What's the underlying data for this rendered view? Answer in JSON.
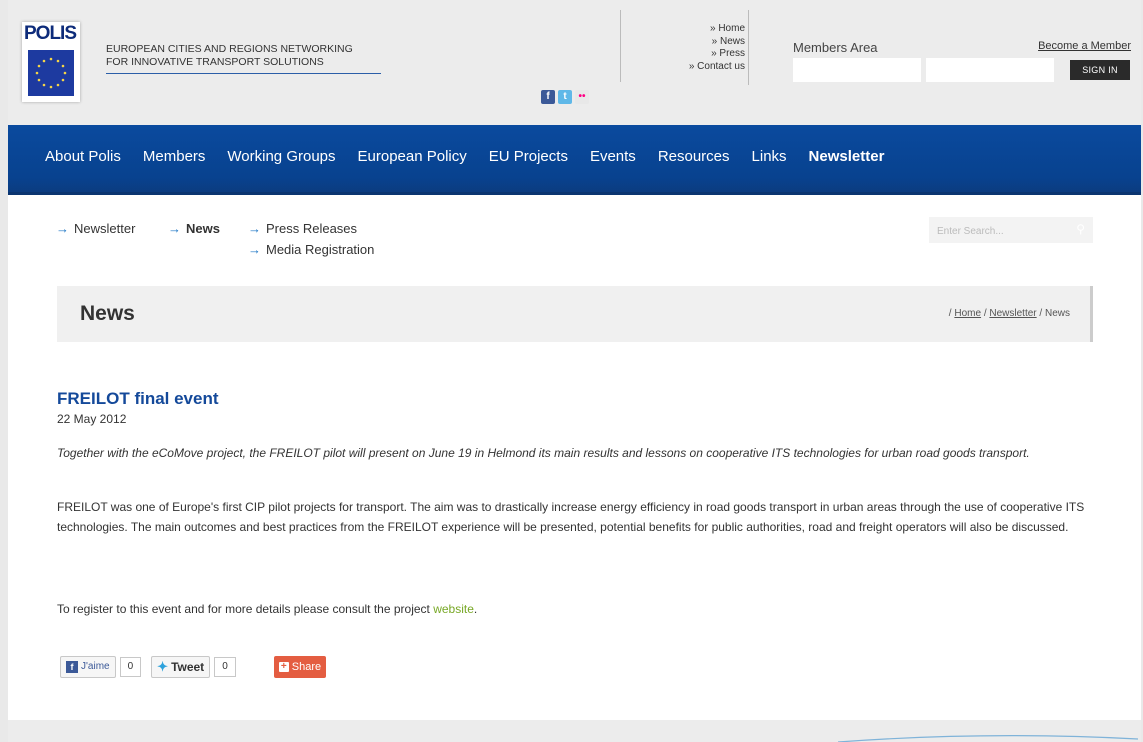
{
  "header": {
    "logo_text": "POLIS",
    "tagline_line1": "EUROPEAN CITIES AND REGIONS NETWORKING",
    "tagline_line2": "FOR INNOVATIVE TRANSPORT SOLUTIONS",
    "social": [
      {
        "icon": "facebook-icon",
        "glyph": "f"
      },
      {
        "icon": "twitter-icon",
        "glyph": "t"
      },
      {
        "icon": "flickr-icon",
        "glyph": "••"
      }
    ],
    "top_links": [
      "» Home",
      "» News",
      "» Press",
      "» Contact us"
    ],
    "members_label": "Members Area",
    "become_member": "Become a Member",
    "sign_in": "SIGN IN"
  },
  "nav": {
    "items": [
      "About Polis",
      "Members",
      "Working Groups",
      "European Policy",
      "EU Projects",
      "Events",
      "Resources",
      "Links",
      "Newsletter"
    ],
    "active": "Newsletter"
  },
  "subnav": {
    "newsletter": "Newsletter",
    "news": "News",
    "press_releases": "Press Releases",
    "media_registration": "Media Registration",
    "arrow_glyph": "→"
  },
  "search": {
    "placeholder": "Enter Search..."
  },
  "titlebar": {
    "title": "News",
    "crumb_sep": "/",
    "crumb_home": "Home",
    "crumb_newsletter": "Newsletter",
    "crumb_current": "News"
  },
  "article": {
    "title": "FREILOT final event",
    "date": "22 May 2012",
    "lead": "Together with the eCoMove project, the FREILOT pilot will present on June 19 in Helmond its main results and lessons on cooperative ITS technologies for urban road goods transport.",
    "body": "FREILOT was one of Europe's first CIP pilot projects for transport. The aim was to drastically increase energy efficiency in road goods transport in urban areas through the use of cooperative ITS technologies. The main outcomes and best practices from the FREILOT experience will be presented, potential benefits for public authorities, road and freight operators will also be discussed.",
    "register_text": "To register to this event and for more details please consult the project ",
    "register_link": "website",
    "register_end": "."
  },
  "share": {
    "like_label": "J'aime",
    "like_count": "0",
    "tweet_label": "Tweet",
    "tweet_count": "0",
    "share_label": "Share"
  },
  "colors": {
    "nav_blue": "#08428f",
    "title_blue": "#14499a",
    "link_green": "#78a826",
    "share_red": "#e45d41"
  }
}
